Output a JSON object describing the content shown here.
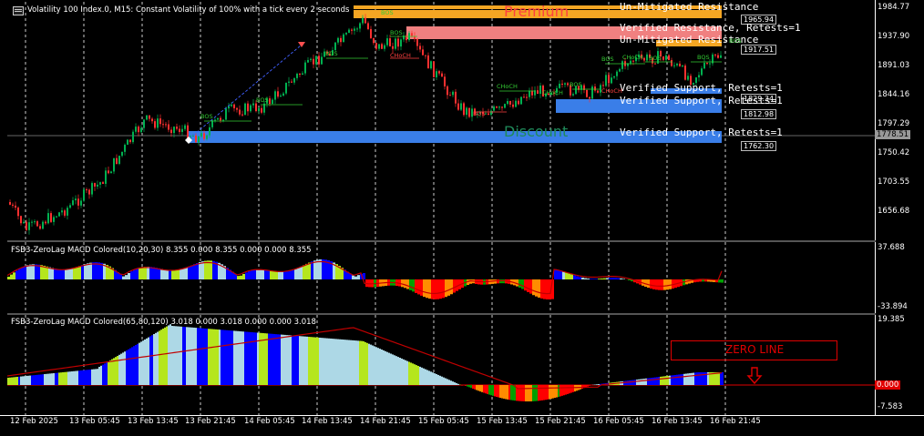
{
  "chart": {
    "title": "Volatility 100 Index.0, M15:  Constant Volatility of 100% with a tick every 2 seconds",
    "menu_icon": "chart-menu-icon",
    "price_axis": [
      "1984.77",
      "1937.90",
      "1891.03",
      "1844.16",
      "1797.29",
      "1750.42",
      "1703.55",
      "1656.68"
    ],
    "current_price": "1778.51",
    "level_tags": [
      "1965.94",
      "1917.51",
      "1829.34",
      "1812.98",
      "1762.30"
    ],
    "zone_texts": [
      "Un-Mitigated Resistance",
      "Verified Resistance, Retests=1",
      "Un-Mitigated Resistance",
      "Verified Support, Retests=1",
      "Verified Support, Retests=1",
      "Verified Support, Retests=1"
    ],
    "premium_label": "Premium",
    "discount_label": "Discount",
    "structure_labels": [
      "BOS",
      "BOS",
      "BOS",
      "BOS",
      "BOS",
      "CHoCH",
      "BOS",
      "CHoCH",
      "BOS",
      "BOS",
      "CHoCH",
      "CHoCH",
      "BOS",
      "BOS",
      "CHoCH",
      "BOS"
    ],
    "colors": {
      "bull": "#00b050",
      "bear": "#ff3030",
      "support_zone": "#3a7ee8",
      "resistance_zone": "#f08080",
      "unmitigated_zone": "#f5a623"
    }
  },
  "indicator1": {
    "title": "FSB3-ZeroLag MACD Colored(10,20,30) 8.355 0.000 8.355 0.000 0.000 8.355",
    "axis_top": "37.688",
    "axis_bottom": "-33.894"
  },
  "indicator2": {
    "title": "FSB3-ZeroLag MACD Colored(65,80,120) 3.018 0.000 3.018 0.000 0.000 3.018",
    "axis_top": "19.385",
    "axis_zero": "0.000",
    "axis_bottom": "-7.583",
    "zero_line_label": "ZERO LINE"
  },
  "time_axis": [
    "12 Feb 2025",
    "13 Feb 05:45",
    "13 Feb 13:45",
    "13 Feb 21:45",
    "14 Feb 05:45",
    "14 Feb 13:45",
    "14 Feb 21:45",
    "15 Feb 05:45",
    "15 Feb 13:45",
    "15 Feb 21:45",
    "16 Feb 05:45",
    "16 Feb 13:45",
    "16 Feb 21:45"
  ]
}
